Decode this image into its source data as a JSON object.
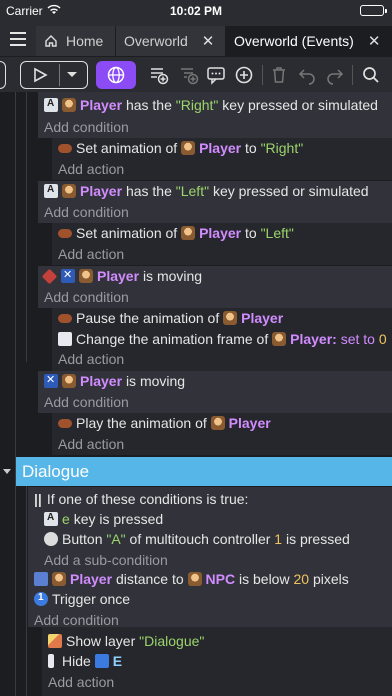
{
  "status": {
    "carrier": "Carrier",
    "time": "10:02 PM"
  },
  "tabs": [
    {
      "label": "Home"
    },
    {
      "label": "Overworld",
      "close": "✕"
    },
    {
      "label": "Overworld (Events)",
      "close": "✕"
    }
  ],
  "toolbar": {
    "icons": [
      "menu-icon",
      "play-icon",
      "chevron-down-icon",
      "globe-icon",
      "add-event-icon",
      "add-sub-event-icon",
      "add-comment-icon",
      "add-icon",
      "delete-icon",
      "undo-icon",
      "redo-icon",
      "search-icon"
    ]
  },
  "events": {
    "e1": {
      "obj": "Player",
      "pre": "has the",
      "key": "\"Right\"",
      "post": "key pressed or simulated",
      "add_condition": "Add condition",
      "action": {
        "pre": "Set animation of",
        "obj": "Player",
        "to": "to",
        "val": "\"Right\""
      },
      "add_action": "Add action"
    },
    "e2": {
      "obj": "Player",
      "pre": "has the",
      "key": "\"Left\"",
      "post": "key pressed or simulated",
      "add_condition": "Add condition",
      "action": {
        "pre": "Set animation of",
        "obj": "Player",
        "to": "to",
        "val": "\"Left\""
      },
      "add_action": "Add action"
    },
    "e3": {
      "obj": "Player",
      "post": "is moving",
      "add_condition": "Add condition",
      "a1": {
        "pre": "Pause the animation of",
        "obj": "Player"
      },
      "a2": {
        "pre": "Change the animation frame of",
        "obj": "Player:",
        "kw": "set to",
        "val": "0"
      },
      "add_action": "Add action"
    },
    "e4": {
      "obj": "Player",
      "post": "is moving",
      "add_condition": "Add condition",
      "a1": {
        "pre": "Play the animation of",
        "obj": "Player"
      },
      "add_action": "Add action"
    }
  },
  "group": {
    "title": "Dialogue"
  },
  "dialogue": {
    "or_label": "If one of these conditions is true:",
    "sub1": {
      "key": "e",
      "post": "key is pressed"
    },
    "sub2": {
      "pre": "Button",
      "btn": "\"A\"",
      "mid": "of multitouch controller",
      "num": "1",
      "post": "is pressed"
    },
    "add_sub": "Add a sub-condition",
    "dist": {
      "obj1": "Player",
      "mid": "distance to",
      "obj2": "NPC",
      "mid2": "is below",
      "num": "20",
      "post": "pixels"
    },
    "trigger": "Trigger once",
    "add_condition": "Add condition",
    "a1": {
      "pre": "Show layer",
      "val": "\"Dialogue\""
    },
    "a2": {
      "pre": "Hide",
      "obj": "E"
    },
    "add_action": "Add action"
  }
}
